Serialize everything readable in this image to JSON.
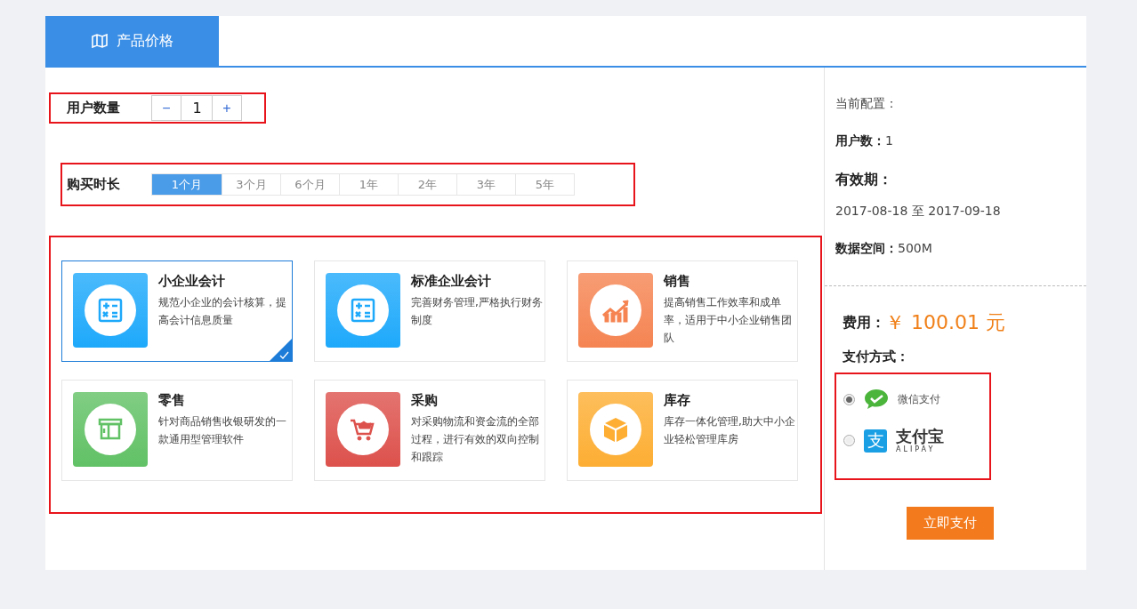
{
  "tab": {
    "label": "产品价格",
    "selected": true
  },
  "user_count": {
    "label": "用户数量",
    "minus": "−",
    "value": "1",
    "plus": "+"
  },
  "duration": {
    "label": "购买时长",
    "options": [
      {
        "label": "1个月",
        "selected": true
      },
      {
        "label": "3个月",
        "selected": false
      },
      {
        "label": "6个月",
        "selected": false
      },
      {
        "label": "1年",
        "selected": false
      },
      {
        "label": "2年",
        "selected": false
      },
      {
        "label": "3年",
        "selected": false
      },
      {
        "label": "5年",
        "selected": false
      }
    ]
  },
  "products": [
    {
      "kind": "calculator",
      "title": "小企业会计",
      "description": "规范小企业的会计核算，提高会计信息质量",
      "color": "#1ea9fb",
      "selected": true
    },
    {
      "kind": "calculator",
      "title": "标准企业会计",
      "description": "完善财务管理,严格执行财务制度",
      "color": "#1ea9fb",
      "selected": false
    },
    {
      "kind": "chart",
      "title": "销售",
      "description": "提高销售工作效率和成单率，适用于中小企业销售团队",
      "color": "#f58452",
      "selected": false
    },
    {
      "kind": "store",
      "title": "零售",
      "description": "针对商品销售收银研发的一款通用型管理软件",
      "color": "#61c165",
      "selected": false
    },
    {
      "kind": "cart",
      "title": "采购",
      "description": "对采购物流和资金流的全部过程，进行有效的双向控制和跟踪",
      "color": "#dd514c",
      "selected": false
    },
    {
      "kind": "box",
      "title": "库存",
      "description": "库存一体化管理,助大中小企业轻松管理库房",
      "color": "#fdae33",
      "selected": false
    }
  ],
  "summary": {
    "heading": "当前配置：",
    "users_label": "用户数：",
    "users_value": "1",
    "validity_label": "有效期：",
    "validity_value": "2017-08-18 至 2017-09-18",
    "storage_label": "数据空间：",
    "storage_value": "500M"
  },
  "fee": {
    "label": "费用：",
    "amount": "￥ 100.01 元"
  },
  "payment": {
    "label": "支付方式：",
    "methods": [
      {
        "kind": "wechat",
        "name": "微信支付",
        "selected": true
      },
      {
        "kind": "alipay",
        "mark": "支",
        "name": "支付宝",
        "subtitle": "ALIPAY",
        "selected": false
      }
    ]
  },
  "pay_button": "立即支付"
}
